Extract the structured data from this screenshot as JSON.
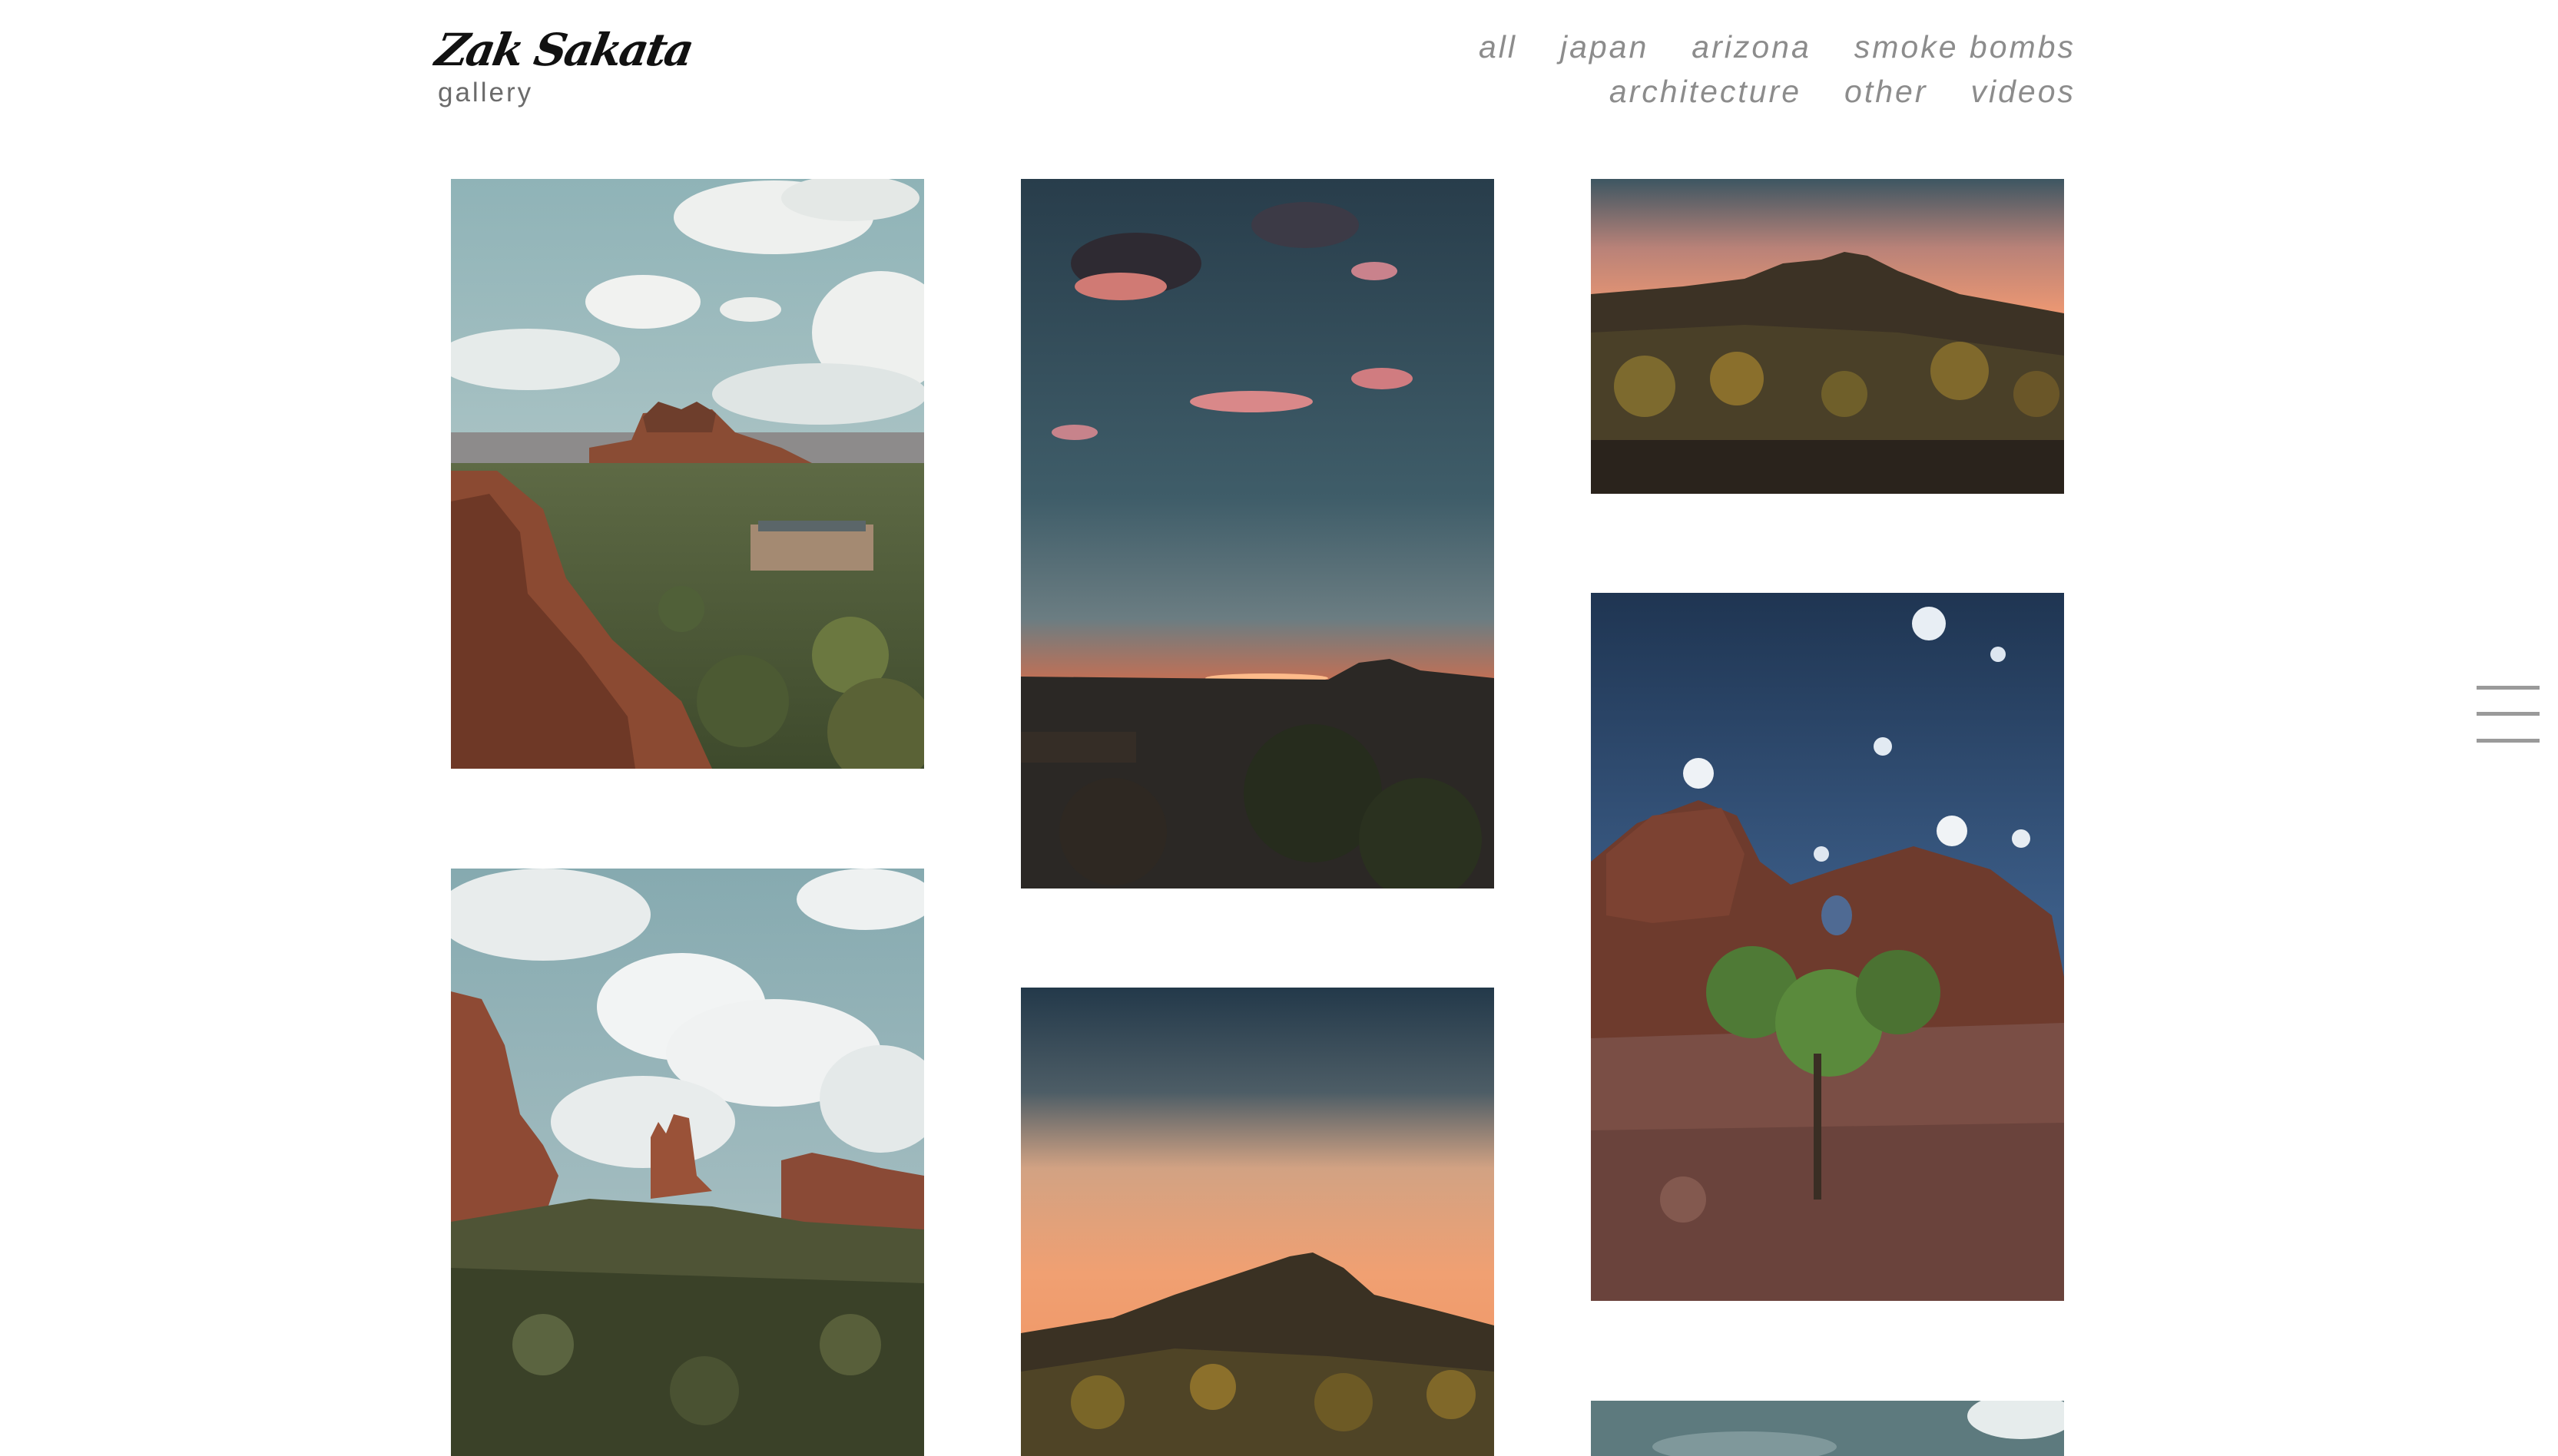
{
  "header": {
    "logo_name": "Zak Sakata",
    "logo_sub": "gallery"
  },
  "nav": {
    "row1": [
      "all",
      "japan",
      "arizona",
      "smoke bombs"
    ],
    "row2": [
      "architecture",
      "other",
      "videos"
    ]
  },
  "menu": {
    "icon": "hamburger-menu-icon"
  },
  "gallery": {
    "photos": [
      {
        "subject": "red rock butte landscape with clouds"
      },
      {
        "subject": "desert sunset with pink clouds"
      },
      {
        "subject": "desert hill at sunset"
      },
      {
        "subject": "red rock formation with shrub under night sky"
      },
      {
        "subject": "red rock spires with cloudy sky"
      },
      {
        "subject": "desert hill silhouette at dusk"
      },
      {
        "subject": "partially visible landscape"
      }
    ]
  },
  "colors": {
    "background": "#ffffff",
    "nav_text": "#8c8c8c",
    "logo_text": "#111111",
    "menu_lines": "#9a9a9a"
  }
}
